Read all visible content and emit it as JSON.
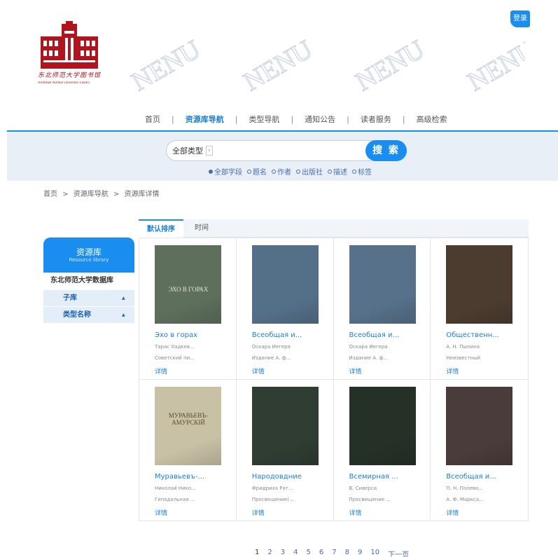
{
  "header": {
    "logo_text": "东北师范大学图书馆",
    "logo_subtext": "Northeast Normal University Library",
    "watermark_text": "NENU",
    "login_label": "登录"
  },
  "nav": {
    "items": [
      {
        "label": "首页",
        "active": false
      },
      {
        "label": "资源库导航",
        "active": true
      },
      {
        "label": "类型导航",
        "active": false
      },
      {
        "label": "通知公告",
        "active": false
      },
      {
        "label": "读者服务",
        "active": false
      },
      {
        "label": "高级检索",
        "active": false
      }
    ],
    "separator": "|"
  },
  "search": {
    "type_label": "全部类型",
    "type_arrow": "∨",
    "placeholder": "",
    "button_label": "搜 索",
    "scopes": [
      {
        "label": "全部字段",
        "checked": true
      },
      {
        "label": "题名",
        "checked": false
      },
      {
        "label": "作者",
        "checked": false
      },
      {
        "label": "出版社",
        "checked": false
      },
      {
        "label": "描述",
        "checked": false
      },
      {
        "label": "标签",
        "checked": false
      }
    ]
  },
  "breadcrumb": [
    "首页",
    ">",
    "资源库导航",
    ">",
    "资源库详情"
  ],
  "sidebar": {
    "title": "资源库",
    "subtitle": "Resource library",
    "library_name": "东北师范大学数据库",
    "sections": [
      {
        "label": "子库",
        "arrow": "▲"
      },
      {
        "label": "类型名称",
        "arrow": "▲"
      }
    ]
  },
  "results": {
    "tabs": [
      {
        "label": "默认排序",
        "active": true
      },
      {
        "label": "时间",
        "active": false
      }
    ],
    "items": [
      {
        "title": "Эхо в горах",
        "author": "Тарас Хадкев...",
        "publisher": "Советский пи...",
        "detail": "详情",
        "cover_color": "#5e6f5c",
        "cover_text": "ЭХО В ГОРАХ"
      },
      {
        "title": "Всеобщая и...",
        "author": "Оскара Иегера",
        "publisher": "Издание А. ф...",
        "detail": "详情",
        "cover_color": "#547088",
        "cover_text": ""
      },
      {
        "title": "Всеобщая и...",
        "author": "Оскара Иегера",
        "publisher": "Издание А. ф...",
        "detail": "详情",
        "cover_color": "#567189",
        "cover_text": ""
      },
      {
        "title": "Общественн...",
        "author": "А. Н. Пыпина",
        "publisher": "Неизвестный",
        "detail": "详情",
        "cover_color": "#4c3c30",
        "cover_text": ""
      },
      {
        "title": "Муравьевъ-...",
        "author": "Николай Нико...",
        "publisher": "Гиподальная ...",
        "detail": "详情",
        "cover_color": "#c9c1a6",
        "cover_text": "МУРАВЬЕВЪ-АМУРСКІЙ"
      },
      {
        "title": "Народовдние",
        "author": "Фридриха Рат...",
        "publisher": "Просвещение(...",
        "detail": "详情",
        "cover_color": "#2f3d33",
        "cover_text": ""
      },
      {
        "title": "Всемирная ...",
        "author": "В. Сиверса",
        "publisher": "Просвещение ...",
        "detail": "详情",
        "cover_color": "#253127",
        "cover_text": ""
      },
      {
        "title": "Всеобщая и...",
        "author": "П. Н. Полево...",
        "publisher": "А. Ф. Маркса...",
        "detail": "详情",
        "cover_color": "#4a3c3a",
        "cover_text": ""
      }
    ]
  },
  "pagination": {
    "pages": [
      "1",
      "2",
      "3",
      "4",
      "5",
      "6",
      "7",
      "8",
      "9",
      "10"
    ],
    "current": "1",
    "next_label": "下一页"
  }
}
